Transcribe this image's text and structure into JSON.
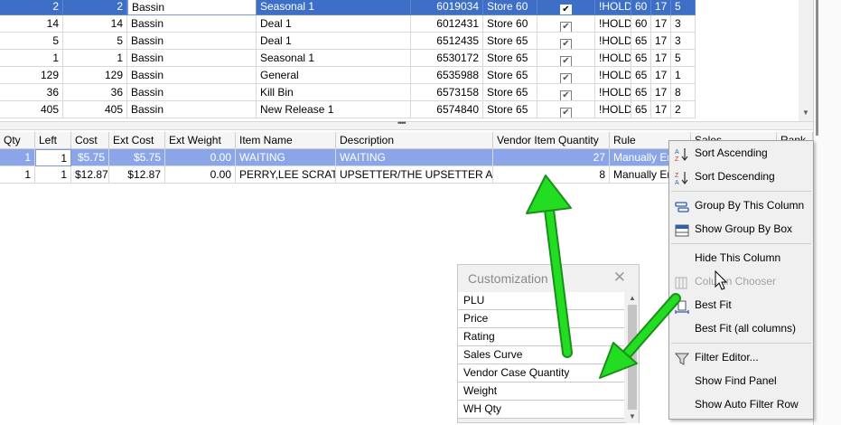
{
  "top_grid": {
    "rows": [
      {
        "a": "2",
        "b": "2",
        "c": "Bassin",
        "d": "",
        "e": "Seasonal 1",
        "f": "6019034",
        "g": "Store 60",
        "h": "✔",
        "i": "!HOLD",
        "j": "60",
        "k": "17",
        "l": "5",
        "selected": true
      },
      {
        "a": "14",
        "b": "14",
        "c": "Bassin",
        "d": "",
        "e": "Deal 1",
        "f": "6012431",
        "g": "Store 60",
        "h": "✔",
        "i": "!HOLD",
        "j": "60",
        "k": "17",
        "l": "3"
      },
      {
        "a": "5",
        "b": "5",
        "c": "Bassin",
        "d": "",
        "e": "Deal 1",
        "f": "6512435",
        "g": "Store 65",
        "h": "✔",
        "i": "!HOLD",
        "j": "65",
        "k": "17",
        "l": "3"
      },
      {
        "a": "1",
        "b": "1",
        "c": "Bassin",
        "d": "",
        "e": "Seasonal 1",
        "f": "6530172",
        "g": "Store 65",
        "h": "✔",
        "i": "!HOLD",
        "j": "65",
        "k": "17",
        "l": "5"
      },
      {
        "a": "129",
        "b": "129",
        "c": "Bassin",
        "d": "",
        "e": "General",
        "f": "6535988",
        "g": "Store 65",
        "h": "✔",
        "i": "!HOLD",
        "j": "65",
        "k": "17",
        "l": "1"
      },
      {
        "a": "36",
        "b": "36",
        "c": "Bassin",
        "d": "",
        "e": "Kill Bin",
        "f": "6573158",
        "g": "Store 65",
        "h": "✔",
        "i": "!HOLD",
        "j": "65",
        "k": "17",
        "l": "8"
      },
      {
        "a": "405",
        "b": "405",
        "c": "Bassin",
        "d": "",
        "e": "New Release 1",
        "f": "6574840",
        "g": "Store 65",
        "h": "✔",
        "i": "!HOLD",
        "j": "65",
        "k": "17",
        "l": "2"
      }
    ]
  },
  "splitter_grip": "••••",
  "bottom_grid": {
    "headers": [
      "Qty",
      "Left",
      "Cost",
      "Ext Cost",
      "Ext Weight",
      "Item Name",
      "Description",
      "Vendor Item Quantity",
      "Rule",
      "Sales...",
      "Rank"
    ],
    "rows": [
      {
        "qty": "1",
        "left": "1",
        "cost": "$5.75",
        "ext_cost": "$5.75",
        "ext_weight": "0.00",
        "item_name": "WAITING",
        "description": "WAITING",
        "vendor_qty": "27",
        "rule": "Manually Er",
        "selected": true
      },
      {
        "qty": "1",
        "left": "1",
        "cost": "$12.87",
        "ext_cost": "$12.87",
        "ext_weight": "0.00",
        "item_name": "PERRY,LEE SCRATCH",
        "description": "UPSETTER/THE UPSETTER AGAIN",
        "vendor_qty": "8",
        "rule": "Manually Er"
      }
    ]
  },
  "customization": {
    "title": "Customization",
    "close_glyph": "✕",
    "items": [
      "PLU",
      "Price",
      "Rating",
      "Sales Curve",
      "Vendor Case Quantity",
      "Weight",
      "WH Qty"
    ]
  },
  "context_menu": {
    "items": [
      {
        "label": "Sort Ascending",
        "icon": "sort-ascending-icon",
        "disabled": false
      },
      {
        "label": "Sort Descending",
        "icon": "sort-descending-icon",
        "disabled": false
      },
      {
        "label": "Group By This Column",
        "icon": "group-by-icon",
        "disabled": false
      },
      {
        "label": "Show Group By Box",
        "icon": "group-box-icon",
        "disabled": false
      },
      {
        "label": "Hide This Column",
        "icon": "",
        "disabled": false
      },
      {
        "label": "Column Chooser",
        "icon": "column-chooser-icon",
        "disabled": true
      },
      {
        "label": "Best Fit",
        "icon": "best-fit-icon",
        "disabled": false
      },
      {
        "label": "Best Fit (all columns)",
        "icon": "",
        "disabled": false
      },
      {
        "label": "Filter Editor...",
        "icon": "filter-icon",
        "disabled": false
      },
      {
        "label": "Show Find Panel",
        "icon": "",
        "disabled": false
      },
      {
        "label": "Show Auto Filter Row",
        "icon": "",
        "disabled": false
      }
    ]
  },
  "colors": {
    "selection": "#3d6fc6",
    "selection_light": "#8aa6e8",
    "annotation_arrow": "#22dd22"
  }
}
